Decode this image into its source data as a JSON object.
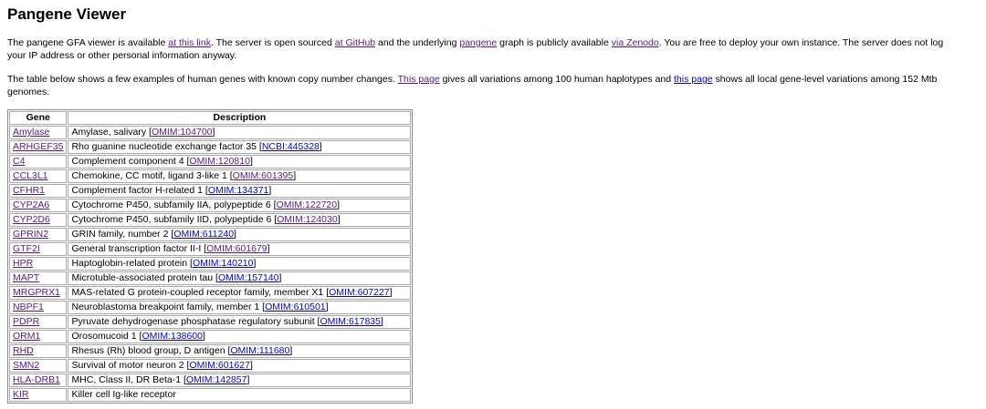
{
  "page": {
    "title": "Pangene Viewer"
  },
  "colors": {
    "link_new": "#0000EE",
    "link_visited": "#551A8B",
    "table_outer_border": "#8b8b8b",
    "table_cell_border": "#ababab"
  },
  "intro": {
    "text_1": "The pangene GFA viewer is available ",
    "link_viewer": "at this link",
    "text_2": ". The server is open sourced ",
    "link_github": "at GitHub",
    "text_3": " and the underlying ",
    "link_pangene": "pangene",
    "text_4": " graph is publicly available ",
    "link_zenodo": "via Zenodo",
    "text_5": ". You are free to deploy your own instance. The server does not log",
    "text_6": "your IP address or other personal information anyway."
  },
  "examples": {
    "text_1": "The table below shows a few examples of human genes with known copy number changes. ",
    "link_human_variations": "This page",
    "text_2": " gives all variations among 100 human haplotypes and ",
    "link_mtb_variations": "this page",
    "text_3": " shows all local gene-level variations among 152 Mtb",
    "text_4": "genomes."
  },
  "table": {
    "headers": [
      "Gene",
      "Description"
    ],
    "rows": [
      {
        "gene": "Amylase",
        "desc_pre": "Amylase, salivary [",
        "link": "OMIM:104700",
        "link_state": "visited",
        "desc_post": "]"
      },
      {
        "gene": "ARHGEF35",
        "desc_pre": "Rho guanine nucleotide exchange factor 35 [",
        "link": "NCBI:445328",
        "link_state": "new",
        "desc_post": "]"
      },
      {
        "gene": "C4",
        "desc_pre": "Complement component 4 [",
        "link": "OMIM:120810",
        "link_state": "visited",
        "desc_post": "]"
      },
      {
        "gene": "CCL3L1",
        "desc_pre": "Chemokine, CC motif, ligand 3-like 1 [",
        "link": "OMIM:601395",
        "link_state": "visited",
        "desc_post": "]"
      },
      {
        "gene": "CFHR1",
        "desc_pre": "Complement factor H-related 1 [",
        "link": "OMIM:134371",
        "link_state": "new",
        "desc_post": "]"
      },
      {
        "gene": "CYP2A6",
        "desc_pre": "Cytochrome P450, subfamily IIA, polypeptide 6 [",
        "link": "OMIM:122720",
        "link_state": "visited",
        "desc_post": "]"
      },
      {
        "gene": "CYP2D6",
        "desc_pre": "Cytochrome P450, subfamily IID, polypeptide 6 [",
        "link": "OMIM:124030",
        "link_state": "visited",
        "desc_post": "]"
      },
      {
        "gene": "GPRIN2",
        "desc_pre": "GRIN family, number 2 [",
        "link": "OMIM:611240",
        "link_state": "new",
        "desc_post": "]"
      },
      {
        "gene": "GTF2I",
        "desc_pre": "General transcription factor II-I [",
        "link": "OMIM:601679",
        "link_state": "visited",
        "desc_post": "]"
      },
      {
        "gene": "HPR",
        "desc_pre": "Haptoglobin-related protein [",
        "link": "OMIM:140210",
        "link_state": "new",
        "desc_post": "]"
      },
      {
        "gene": "MAPT",
        "desc_pre": "Microtuble-associated protein tau [",
        "link": "OMIM:157140",
        "link_state": "new",
        "desc_post": "]"
      },
      {
        "gene": "MRGPRX1",
        "desc_pre": "MAS-related G protein-coupled receptor family, member X1 [",
        "link": "OMIM:607227",
        "link_state": "new",
        "desc_post": "]"
      },
      {
        "gene": "NBPF1",
        "desc_pre": "Neuroblastoma breakpoint family, member 1 [",
        "link": "OMIM:610501",
        "link_state": "new",
        "desc_post": "]"
      },
      {
        "gene": "PDPR",
        "desc_pre": "Pyruvate dehydrogenase phosphatase regulatory subunit [",
        "link": "OMIM:617835",
        "link_state": "new",
        "desc_post": "]"
      },
      {
        "gene": "ORM1",
        "desc_pre": "Orosomucoid 1 [",
        "link": "OMIM:138600",
        "link_state": "new",
        "desc_post": "]"
      },
      {
        "gene": "RHD",
        "desc_pre": "Rhesus (Rh) blood group, D antigen [",
        "link": "OMIM:111680",
        "link_state": "new",
        "desc_post": "]"
      },
      {
        "gene": "SMN2",
        "desc_pre": "Survival of motor neuron 2 [",
        "link": "OMIM:601627",
        "link_state": "new",
        "desc_post": "]"
      },
      {
        "gene": "HLA-DRB1",
        "desc_pre": "MHC, Class II, DR Beta-1 [",
        "link": "OMIM:142857",
        "link_state": "new",
        "desc_post": "]"
      },
      {
        "gene": "KIR",
        "desc_pre": "Killer cell Ig-like receptor",
        "link": null,
        "link_state": null,
        "desc_post": ""
      }
    ]
  }
}
